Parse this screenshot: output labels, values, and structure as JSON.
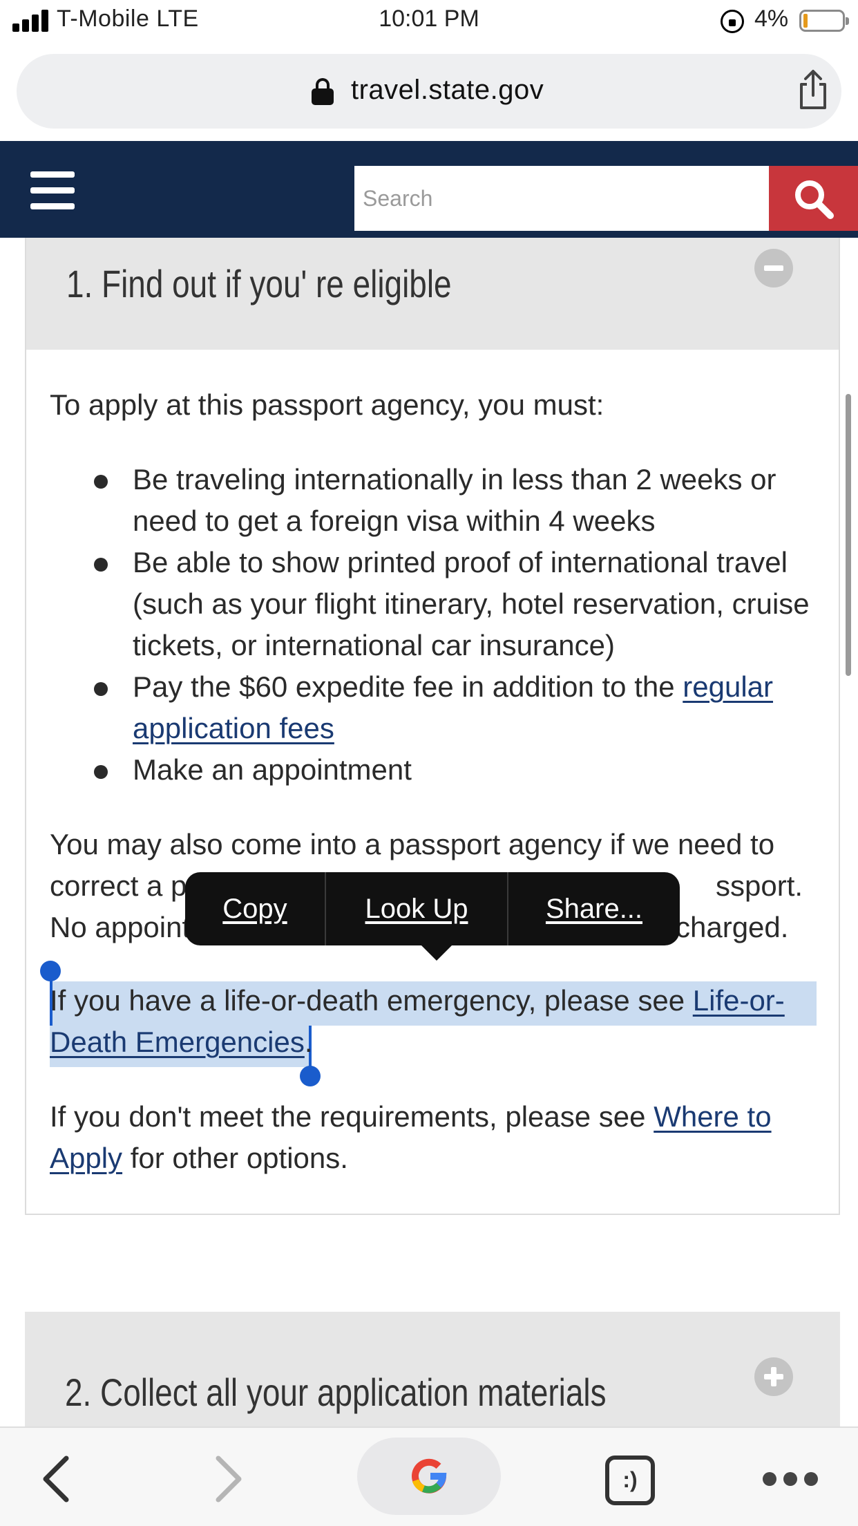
{
  "status_bar": {
    "carrier": "T-Mobile LTE",
    "time": "10:01 PM",
    "battery": "4%"
  },
  "browser": {
    "url": "travel.state.gov",
    "search_placeholder": "Search"
  },
  "section1": {
    "title": "1. Find out if you' re eligible",
    "state": "expanded",
    "intro": "To apply at this passport agency, you must:",
    "requirements": [
      {
        "text": "Be traveling internationally in less than 2 weeks or need to get a foreign visa within 4 weeks"
      },
      {
        "text": "Be able to show printed proof of international travel (such as your flight itinerary, hotel reservation, cruise tickets, or international car insurance)"
      },
      {
        "text_before": "Pay the $60 expedite fee in addition to the ",
        "link": "regular application fees"
      },
      {
        "text": "Make an appointment"
      }
    ],
    "para_may_lines": [
      "You may also come into a passport agency if we need to",
      "correct a p",
      "ssport.",
      "No appoint",
      "charged."
    ],
    "para_life_before": "If you have a life-or-death emergency, please see ",
    "para_life_link": "Life-or-Death Emergencies",
    "para_life_after": ".",
    "para_dont_before": "If you don't meet the requirements, please see ",
    "para_dont_link": "Where to Apply",
    "para_dont_after": " for other options."
  },
  "context_menu": {
    "copy": "Copy",
    "look_up": "Look Up",
    "share": "Share..."
  },
  "section2": {
    "title": "2. Collect all your application materials",
    "state": "collapsed"
  },
  "toolbar": {
    "tabs_label": ":)"
  },
  "colors": {
    "header_navy": "#13294b",
    "search_red": "#c8363c",
    "link_blue": "#1a3a72",
    "selection": "#cadcf1",
    "selection_handle": "#1a5ccc",
    "accordion_gray": "#e6e6e6"
  },
  "icons": [
    "signal-icon",
    "rotation-lock-icon",
    "battery-icon",
    "lock-icon",
    "share-icon",
    "menu-icon",
    "search-icon",
    "minus-circle-icon",
    "plus-circle-icon",
    "back-icon",
    "forward-icon",
    "google-icon",
    "tabs-icon",
    "more-icon"
  ]
}
